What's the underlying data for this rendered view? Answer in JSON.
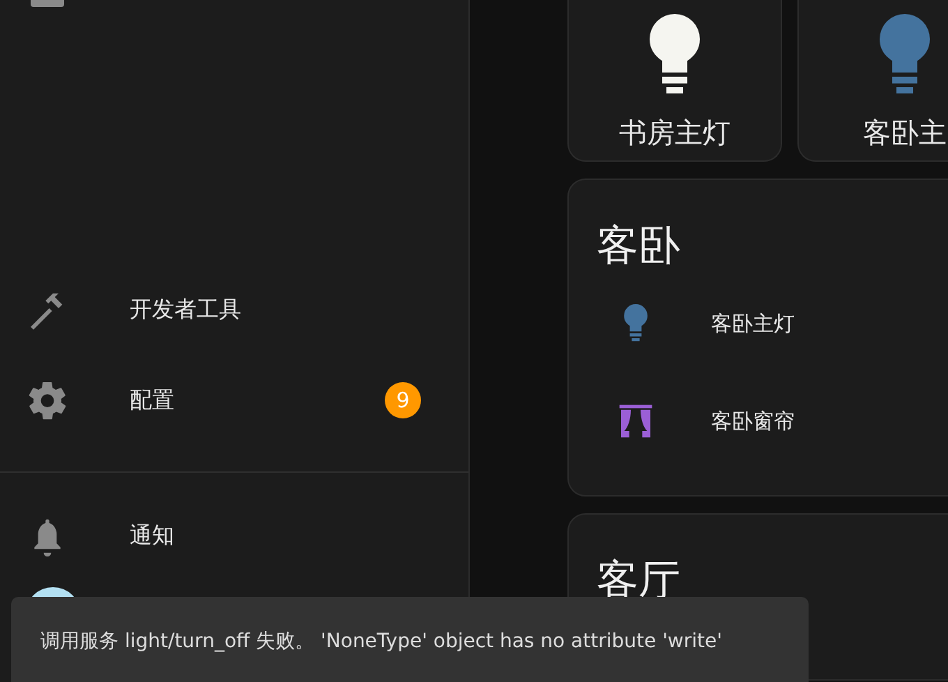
{
  "sidebar": {
    "items": [
      {
        "label": "开发者工具"
      },
      {
        "label": "配置",
        "badge": "9"
      }
    ],
    "footer": [
      {
        "label": "通知"
      }
    ]
  },
  "tiles": [
    {
      "name": "书房主灯",
      "on": true
    },
    {
      "name": "客卧主",
      "on": false
    }
  ],
  "cards": [
    {
      "title": "客卧",
      "entities": [
        {
          "name": "客卧主灯",
          "kind": "light",
          "on": false
        },
        {
          "name": "客卧窗帘",
          "kind": "curtain"
        }
      ]
    },
    {
      "title": "客厅"
    }
  ],
  "toast": {
    "message": "调用服务 light/turn_off 失败。 'NoneType' object has no attribute 'write'"
  }
}
